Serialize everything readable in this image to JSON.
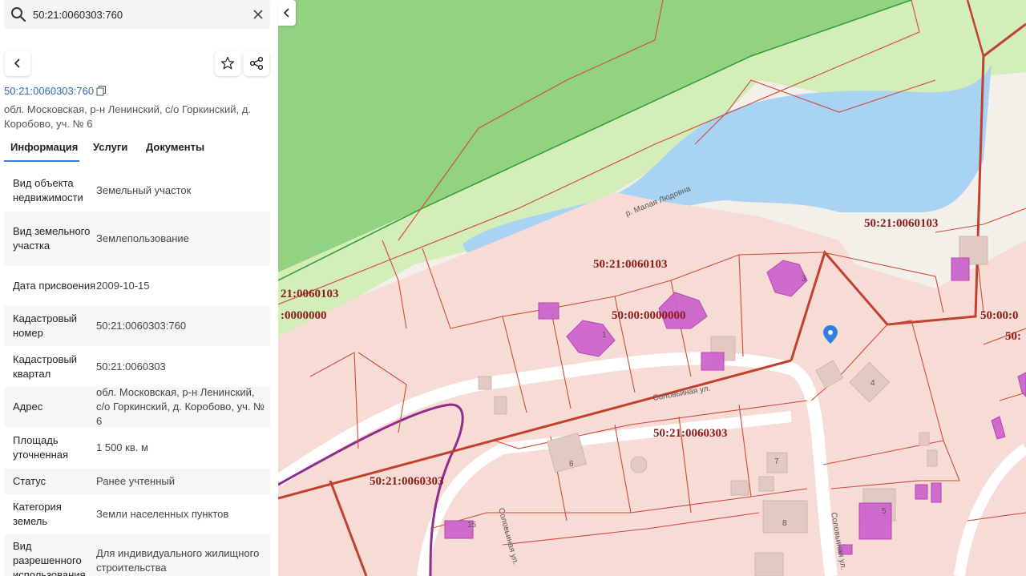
{
  "search": {
    "value": "50:21:0060303:760"
  },
  "parcel": {
    "cadastral_number": "50:21:0060303:760",
    "address": "обл. Московская, р-н Ленинский, с/о Горкинский, д. Коробово, уч. № 6"
  },
  "tabs": [
    "Информация",
    "Услуги",
    "Документы"
  ],
  "info_rows": [
    {
      "key": "Вид объекта недвижимости",
      "value": "Земельный участок"
    },
    {
      "key": "Вид земельного участка",
      "value": "Землепользование"
    },
    {
      "key": "Дата присвоения",
      "value": "2009-10-15"
    },
    {
      "key": "Кадастровый номер",
      "value": "50:21:0060303:760"
    },
    {
      "key": "Кадастровый квартал",
      "value": "50:21:0060303"
    },
    {
      "key": "Адрес",
      "value": "обл. Московская, р-н Ленинский, с/о Горкинский, д. Коробово, уч. № 6"
    },
    {
      "key": "Площадь уточненная",
      "value": "1 500 кв. м"
    },
    {
      "key": "Статус",
      "value": "Ранее учтенный"
    },
    {
      "key": "Категория земель",
      "value": "Земли населенных пунктов"
    },
    {
      "key": "Вид разрешенного использования",
      "value": "Для индивидуального жилищного строительства"
    }
  ],
  "map": {
    "labels": {
      "q1": "50:21:0060103",
      "q2": "50:21:0060103",
      "q3": "21:0060103",
      "q4": ":0000000",
      "q5": "50:00:0000000",
      "q6": "50:21:0060303",
      "q7": "50:21:0060303",
      "q8": "50:00:0",
      "q9": "50:"
    },
    "river": "р. Малая Людовна",
    "streets": {
      "s1": "Соловьиная ул.",
      "s2": "Соловьиная ул.",
      "s3": "Соловьиная ул."
    },
    "house_numbers": {
      "h1": "1",
      "h3": "3",
      "h4": "4",
      "h5": "5",
      "h6": "6",
      "h7": "7",
      "h8": "8",
      "h15": "15"
    }
  },
  "colors": {
    "accent": "#3a7bd5",
    "parcel_border": "#d0483a",
    "building": "#cc66cc",
    "water": "#a9d3f2",
    "forest": "#8fd07f"
  }
}
